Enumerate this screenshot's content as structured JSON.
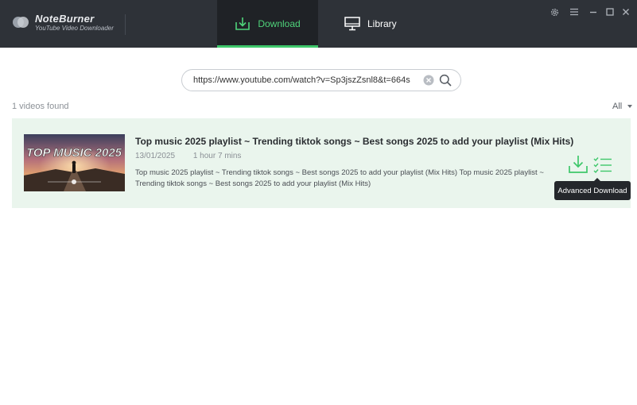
{
  "app": {
    "name": "NoteBurner",
    "subtitle": "YouTube Video Downloader"
  },
  "tabs": [
    {
      "label": "Download",
      "icon": "download-tray-icon",
      "active": true
    },
    {
      "label": "Library",
      "icon": "monitor-icon",
      "active": false
    }
  ],
  "window_controls": [
    "gear-icon",
    "menu-icon",
    "minimize-icon",
    "maximize-icon",
    "close-icon"
  ],
  "search": {
    "value": "https://www.youtube.com/watch?v=Sp3jszZsnl8&t=664s",
    "clear_icon": "clear-icon",
    "search_icon": "search-icon"
  },
  "results": {
    "count_label": "1 videos found",
    "filter_label": "All"
  },
  "video": {
    "thumbnail_text": "TOP MUSIC 2025",
    "title": "Top music 2025 playlist ~ Trending tiktok songs ~ Best songs 2025 to add your playlist (Mix Hits)",
    "date": "13/01/2025",
    "duration": "1 hour 7 mins",
    "description": "Top music 2025 playlist ~ Trending tiktok songs ~ Best songs 2025 to add your playlist (Mix Hits) Top music 2025 playlist ~ Trending tiktok songs ~ Best songs 2025 to add your playlist (Mix Hits) ———————————————————————— ♫..."
  },
  "actions": {
    "tooltip": "Advanced Download"
  },
  "colors": {
    "titlebar": "#2e3238",
    "accent_green": "#3ec76a",
    "card_bg": "#eaf5ed",
    "tooltip_bg": "#24272b"
  }
}
